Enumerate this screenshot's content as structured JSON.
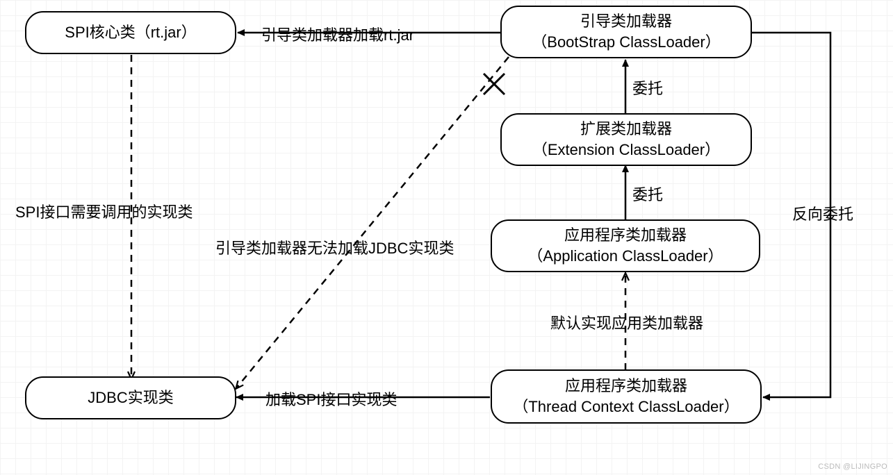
{
  "nodes": {
    "spi_core": {
      "line1": "SPI核心类（rt.jar）"
    },
    "jdbc_impl": {
      "line1": "JDBC实现类"
    },
    "bootstrap": {
      "line1": "引导类加载器",
      "line2": "（BootStrap ClassLoader）"
    },
    "extension": {
      "line1": "扩展类加载器",
      "line2": "（Extension ClassLoader）"
    },
    "application": {
      "line1": "应用程序类加载器",
      "line2": "（Application ClassLoader）"
    },
    "thread_ctx": {
      "line1": "应用程序类加载器",
      "line2": "（Thread Context ClassLoader）"
    }
  },
  "edges": {
    "bootstrap_to_spi": "引导类加载器加载rt.jar",
    "spi_to_jdbc": "SPI接口需要调用的实现类",
    "bootstrap_to_jdbc_fail": "引导类加载器无法加载JDBC实现类",
    "ext_to_bootstrap": "委托",
    "app_to_ext": "委托",
    "tcc_to_app": "默认实现应用类加载器",
    "tcc_to_jdbc": "加载SPI接口实现类",
    "bootstrap_to_tcc": "反向委托"
  },
  "watermark": "CSDN @LIJINGPO"
}
